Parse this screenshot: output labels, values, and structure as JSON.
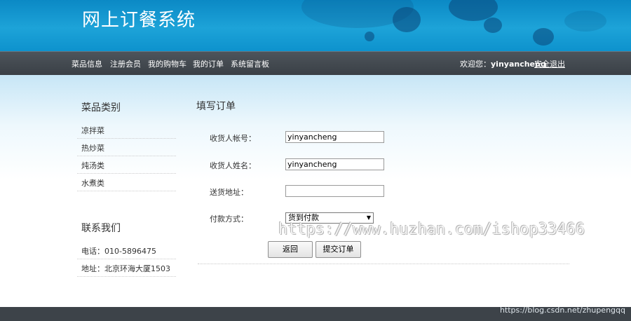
{
  "site": {
    "title": "网上订餐系统"
  },
  "nav": {
    "items": [
      "菜品信息",
      "注册会员",
      "我的购物车",
      "我的订单",
      "系统留言板"
    ],
    "welcome_prefix": "欢迎您：",
    "username": "yinyancheng",
    "logout_label": "安全退出"
  },
  "sidebar": {
    "categories_title": "菜品类别",
    "categories": [
      "凉拌菜",
      "热炒菜",
      "炖汤类",
      "水煮类"
    ],
    "contact_title": "联系我们",
    "contact": [
      "电话：010-5896475",
      "地址：北京环海大厦1503"
    ]
  },
  "form": {
    "title": "填写订单",
    "fields": [
      {
        "label": "收货人帐号：",
        "value": "yinyancheng"
      },
      {
        "label": "收货人姓名：",
        "value": "yinyancheng"
      },
      {
        "label": "送货地址：",
        "value": ""
      }
    ],
    "payment_label": "付款方式：",
    "payment_selected": "货到付款",
    "back_button": "返回",
    "submit_button": "提交订单"
  },
  "watermark": "https://www.huzhan.com/ishop33466",
  "footer": {
    "credit": "https://blog.csdn.net/zhupengqq"
  },
  "colors": {
    "banner": "#0b89c5",
    "navbar": "#41474d",
    "footer": "#3d4349"
  }
}
